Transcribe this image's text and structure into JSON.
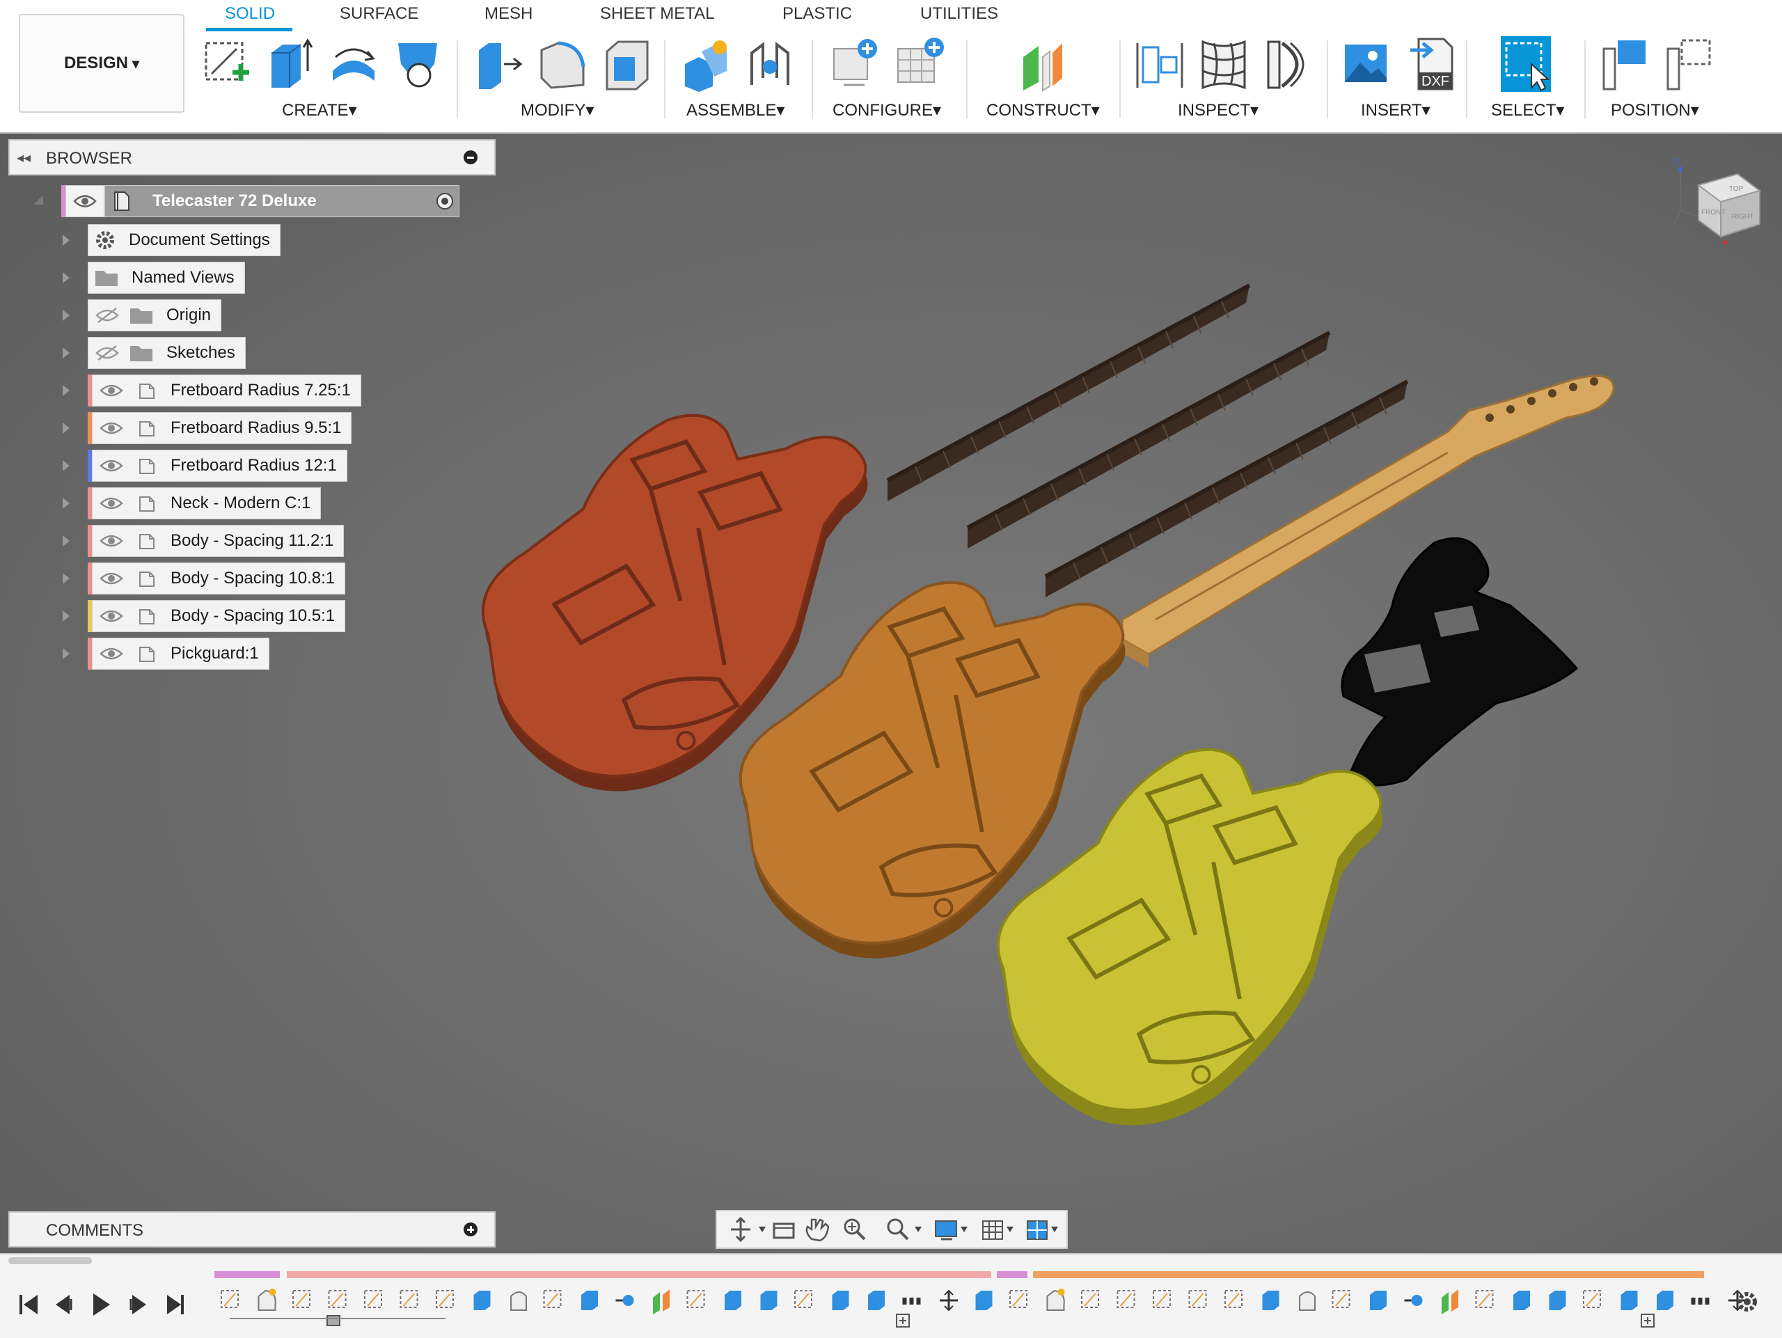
{
  "app": {
    "workspace": "DESIGN",
    "tabs": [
      {
        "label": "SOLID",
        "active": true
      },
      {
        "label": "SURFACE",
        "active": false
      },
      {
        "label": "MESH",
        "active": false
      },
      {
        "label": "SHEET METAL",
        "active": false
      },
      {
        "label": "PLASTIC",
        "active": false
      },
      {
        "label": "UTILITIES",
        "active": false
      }
    ],
    "groups": {
      "create": "CREATE",
      "modify": "MODIFY",
      "assemble": "ASSEMBLE",
      "configure": "CONFIGURE",
      "construct": "CONSTRUCT",
      "inspect": "INSPECT",
      "insert": "INSERT",
      "select": "SELECT",
      "position": "POSITION"
    },
    "dropdown_glyph": "▾",
    "insert_dxf": "DXF",
    "accent": "#0696d7"
  },
  "browser": {
    "title": "BROWSER",
    "root": "Telecaster 72 Deluxe",
    "items": [
      {
        "label": "Document Settings",
        "icon": "gear-icon"
      },
      {
        "label": "Named Views",
        "icon": "folder-icon"
      },
      {
        "label": "Origin",
        "icon": "folder-icon",
        "hidden": true
      },
      {
        "label": "Sketches",
        "icon": "folder-icon",
        "hidden": true
      },
      {
        "label": "Fretboard Radius 7.25:1",
        "icon": "component-icon",
        "color": "#e98f8f"
      },
      {
        "label": "Fretboard Radius 9.5:1",
        "icon": "component-icon",
        "color": "#e98f5a"
      },
      {
        "label": "Fretboard Radius 12:1",
        "icon": "component-icon",
        "color": "#5a7de9"
      },
      {
        "label": "Neck - Modern C:1",
        "icon": "component-icon",
        "color": "#e98f8f"
      },
      {
        "label": "Body - Spacing 11.2:1",
        "icon": "component-icon",
        "color": "#e98f8f"
      },
      {
        "label": "Body - Spacing 10.8:1",
        "icon": "component-icon",
        "color": "#e98f8f"
      },
      {
        "label": "Body - Spacing 10.5:1",
        "icon": "component-icon",
        "color": "#e9c85a"
      },
      {
        "label": "Pickguard:1",
        "icon": "component-icon",
        "color": "#e98f8f"
      }
    ]
  },
  "viewcube": {
    "top": "TOP",
    "front": "FRONT",
    "right": "RIGHT",
    "axis_z": "Z"
  },
  "comments": {
    "title": "COMMENTS"
  }
}
